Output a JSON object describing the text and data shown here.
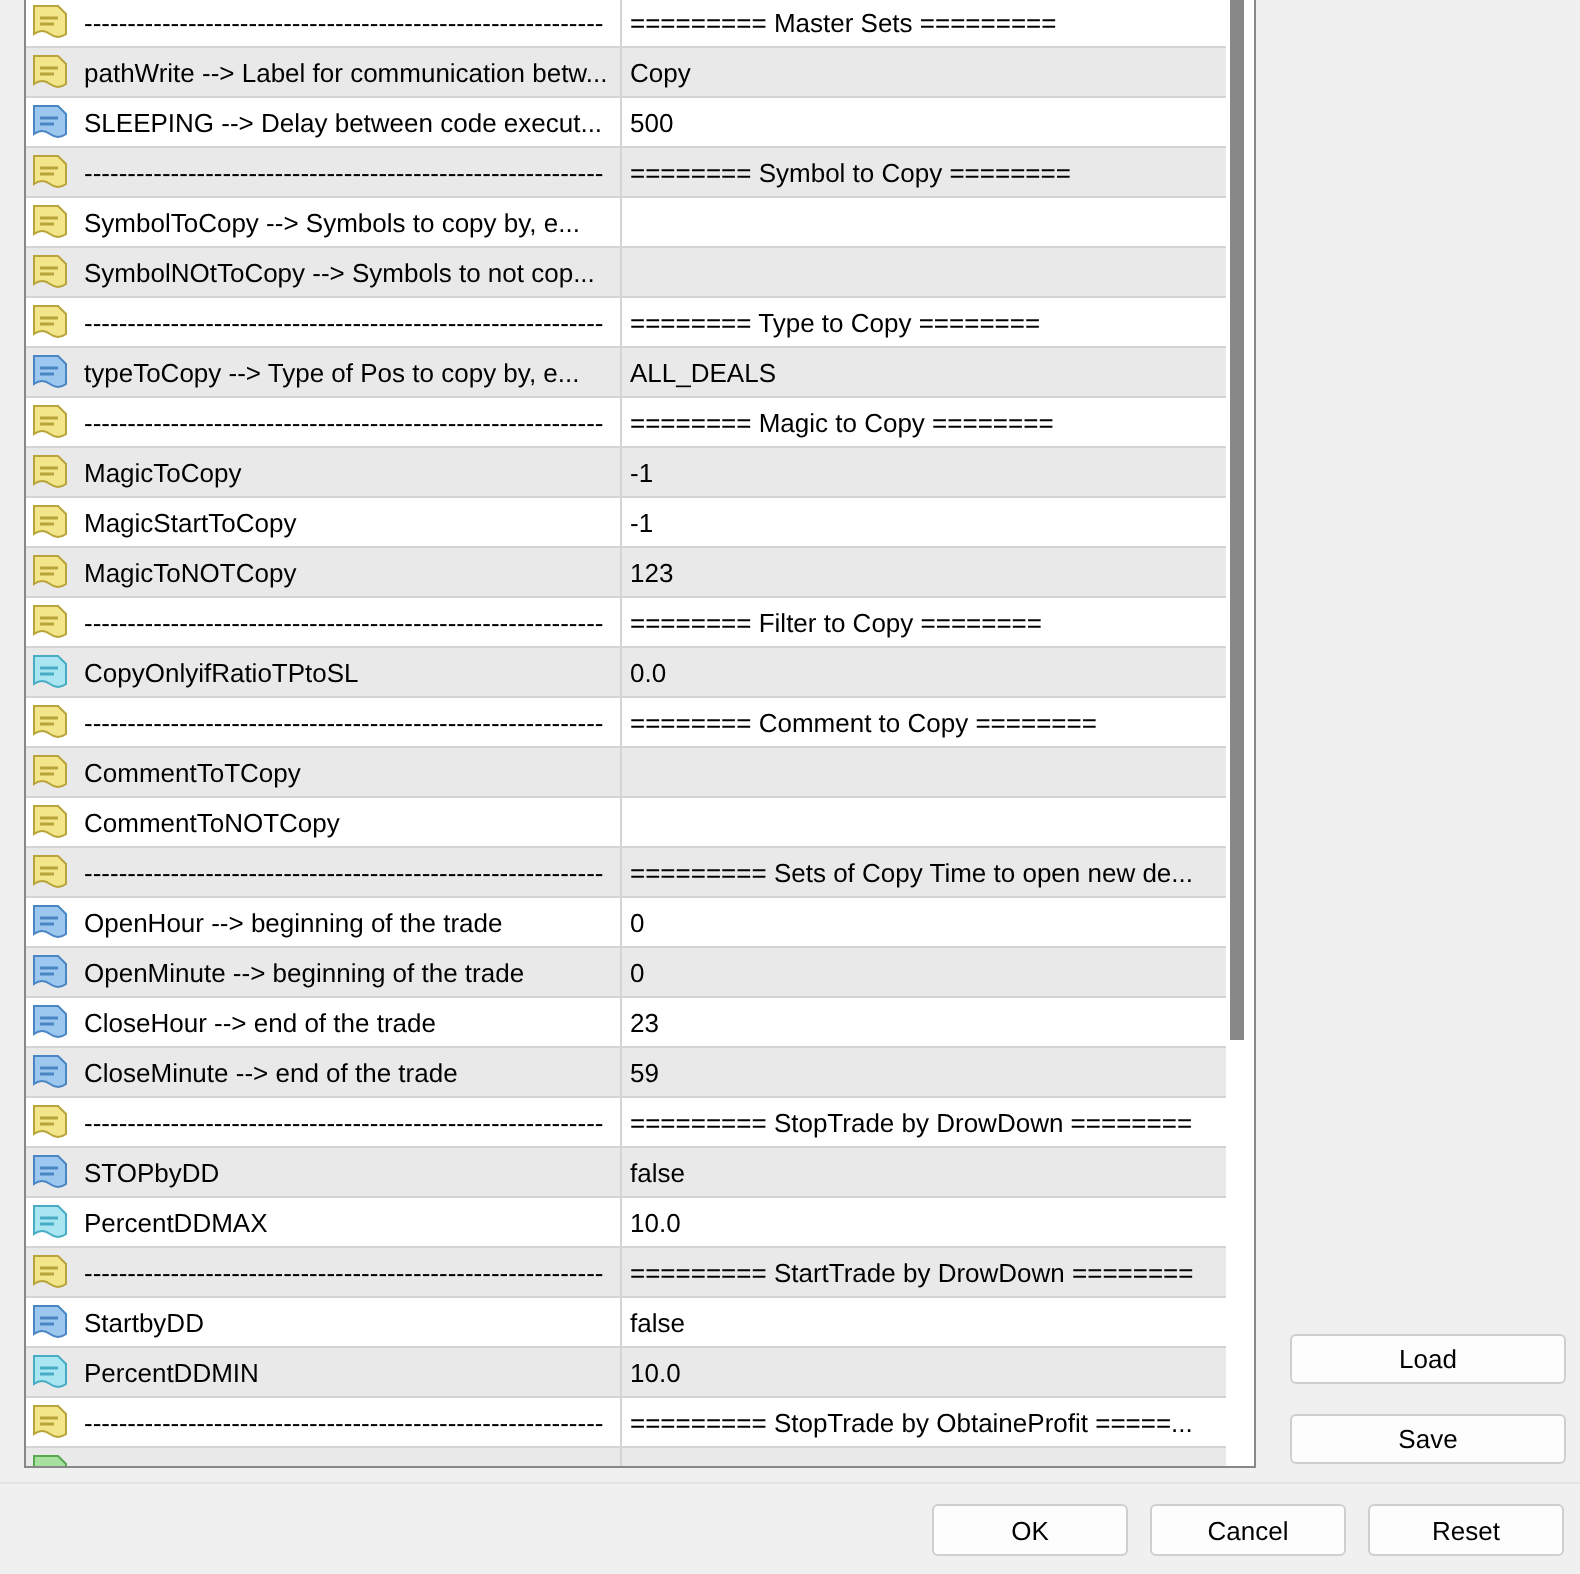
{
  "rows": [
    {
      "kind": "text",
      "name": "------------------------------------------------------------",
      "value": "=========   Master Sets  ========="
    },
    {
      "kind": "text",
      "name": "pathWrite --> Label for communication betw...",
      "value": "Copy"
    },
    {
      "kind": "int",
      "name": "SLEEPING --> Delay between code execut...",
      "value": "500"
    },
    {
      "kind": "text",
      "name": "------------------------------------------------------------",
      "value": " ======== Symbol to Copy ========"
    },
    {
      "kind": "text",
      "name": "SymbolToCopy --> Symbols to copy by, e..."
    },
    {
      "kind": "text",
      "name": "SymbolNOtToCopy --> Symbols to not cop..."
    },
    {
      "kind": "text",
      "name": "------------------------------------------------------------",
      "value": " ======== Type to Copy ========"
    },
    {
      "kind": "int",
      "name": "typeToCopy --> Type of Pos to copy by, e...",
      "value": "ALL_DEALS"
    },
    {
      "kind": "text",
      "name": "------------------------------------------------------------",
      "value": " ======== Magic to Copy ========"
    },
    {
      "kind": "text",
      "name": "MagicToCopy",
      "value": "-1"
    },
    {
      "kind": "text",
      "name": "MagicStartToCopy",
      "value": "-1"
    },
    {
      "kind": "text",
      "name": "MagicToNOTCopy",
      "value": "123"
    },
    {
      "kind": "text",
      "name": "------------------------------------------------------------",
      "value": " ======== Filter to Copy ========"
    },
    {
      "kind": "double",
      "name": "CopyOnlyifRatioTPtoSL",
      "value": "0.0"
    },
    {
      "kind": "text",
      "name": "------------------------------------------------------------",
      "value": " ======== Comment to Copy ========"
    },
    {
      "kind": "text",
      "name": "CommentToTCopy"
    },
    {
      "kind": "text",
      "name": "CommentToNOTCopy"
    },
    {
      "kind": "text",
      "name": "------------------------------------------------------------",
      "value": "=========   Sets of Copy Time to open new de..."
    },
    {
      "kind": "int",
      "name": "OpenHour --> beginning of the trade",
      "value": "0"
    },
    {
      "kind": "int",
      "name": "OpenMinute --> beginning of the trade",
      "value": "0"
    },
    {
      "kind": "int",
      "name": "CloseHour --> end of the trade",
      "value": "23"
    },
    {
      "kind": "int",
      "name": "CloseMinute --> end of the trade",
      "value": "59"
    },
    {
      "kind": "text",
      "name": "------------------------------------------------------------",
      "value": "=========   StopTrade by DrowDown ========"
    },
    {
      "kind": "int",
      "name": "STOPbyDD",
      "value": "false"
    },
    {
      "kind": "double",
      "name": "PercentDDMAX",
      "value": "10.0"
    },
    {
      "kind": "text",
      "name": "------------------------------------------------------------",
      "value": "=========   StartTrade by DrowDown ========"
    },
    {
      "kind": "int",
      "name": "StartbyDD",
      "value": "false"
    },
    {
      "kind": "double",
      "name": "PercentDDMIN",
      "value": "10.0"
    },
    {
      "kind": "text",
      "name": "------------------------------------------------------------",
      "value": "=========   StopTrade by ObtaineProfit =====..."
    },
    {
      "kind": "bool"
    }
  ],
  "side_buttons": [
    "Load",
    "Save"
  ],
  "buttons": [
    "OK",
    "Cancel",
    "Reset"
  ]
}
